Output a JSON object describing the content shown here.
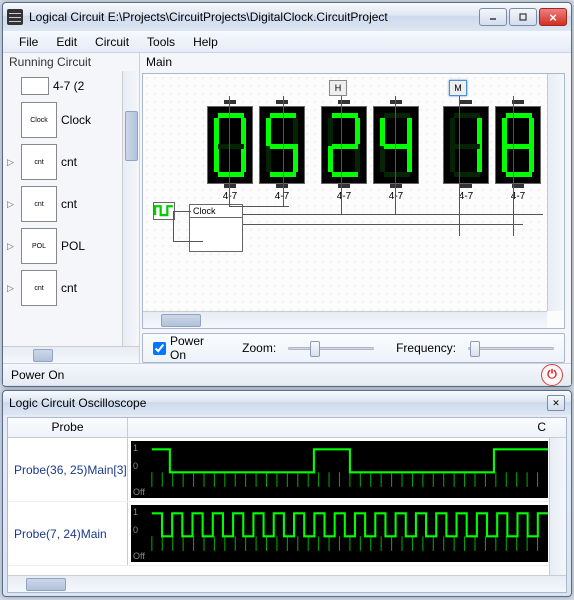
{
  "window": {
    "title": "Logical Circuit E:\\Projects\\CircuitProjects\\DigitalClock.CircuitProject"
  },
  "menu": {
    "file": "File",
    "edit": "Edit",
    "circuit": "Circuit",
    "tools": "Tools",
    "help": "Help"
  },
  "tree": {
    "header": "Running Circuit",
    "items": [
      {
        "label": "4-7 (2",
        "icon": ""
      },
      {
        "label": "Clock",
        "icon": "Clock"
      },
      {
        "label": "cnt",
        "icon": "cnt",
        "expandable": true
      },
      {
        "label": "cnt",
        "icon": "cnt",
        "expandable": true
      },
      {
        "label": "POL",
        "icon": "POL",
        "expandable": true
      },
      {
        "label": "cnt",
        "icon": "cnt",
        "expandable": true
      }
    ]
  },
  "canvas": {
    "header": "Main",
    "labelH": "H",
    "labelM": "M",
    "segLabel": "4-7",
    "clockLabel": "Clock",
    "digits": [
      "0",
      "5",
      "2",
      "4",
      "1",
      "8"
    ]
  },
  "controls": {
    "powerOn": "Power On",
    "powerOnChecked": true,
    "zoom": "Zoom:",
    "frequency": "Frequency:"
  },
  "status": {
    "text": "Power On"
  },
  "osc": {
    "title": "Logic Circuit Oscilloscope",
    "colProbe": "Probe",
    "colC": "C",
    "probes": [
      {
        "name": "Probe(36, 25)Main[3]",
        "y1": "1",
        "y0": "0",
        "off": "Off"
      },
      {
        "name": "Probe(7, 24)Main",
        "y1": "1",
        "y0": "0",
        "off": "Off"
      }
    ]
  },
  "chart_data": [
    {
      "type": "line",
      "title": "Probe(36, 25)Main[3]",
      "ylabel": "",
      "xlabel": "",
      "ylim": [
        0,
        1
      ],
      "values": [
        1,
        0,
        0,
        0,
        0,
        0,
        0,
        0,
        0,
        1,
        1,
        0,
        0,
        0,
        0,
        0,
        0,
        0,
        0,
        1,
        1,
        1
      ]
    },
    {
      "type": "line",
      "title": "Probe(7, 24)Main",
      "ylabel": "",
      "xlabel": "",
      "ylim": [
        0,
        1
      ],
      "values": [
        1,
        0,
        1,
        0,
        1,
        0,
        1,
        0,
        1,
        0,
        1,
        0,
        1,
        0,
        1,
        0,
        1,
        0,
        1,
        0,
        1,
        0,
        1,
        0,
        1,
        0,
        1,
        0,
        1,
        0,
        1,
        0,
        1,
        0,
        1,
        0,
        1,
        0,
        1
      ]
    }
  ]
}
